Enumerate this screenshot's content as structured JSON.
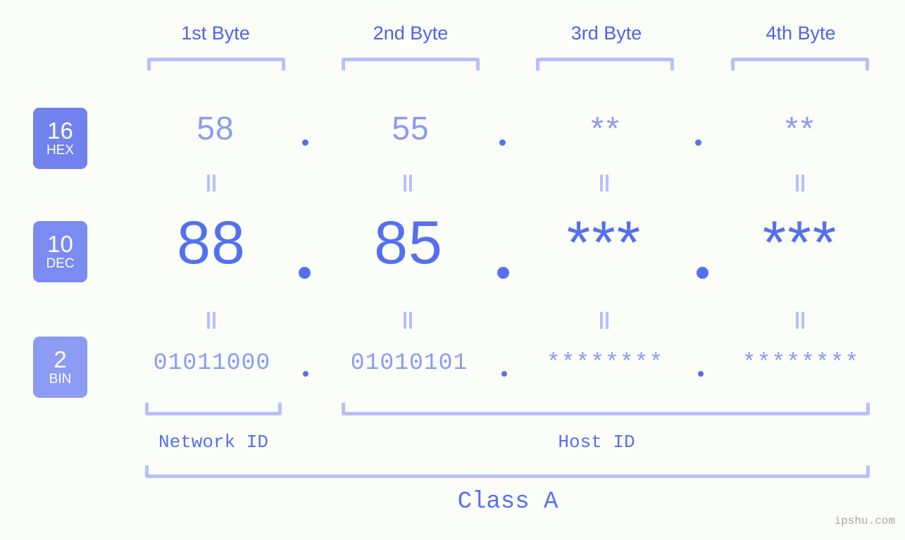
{
  "meta": {
    "background": "#fbfdf8",
    "accent_strong": "#5570ef",
    "accent_light": "#8b9bf2",
    "bracket_color": "#b7c0fb",
    "badge_hex_bg": "#7181ee",
    "badge_dec_bg": "#7b8bf1",
    "badge_bin_bg": "#8c9bf4"
  },
  "byte_headers": [
    {
      "label": "1st Byte"
    },
    {
      "label": "2nd Byte"
    },
    {
      "label": "3rd Byte"
    },
    {
      "label": "4th Byte"
    }
  ],
  "radix_badges": [
    {
      "number": "16",
      "label": "HEX"
    },
    {
      "number": "10",
      "label": "DEC"
    },
    {
      "number": "2",
      "label": "BIN"
    }
  ],
  "rows": {
    "hex": {
      "radix": "16",
      "radix_label": "HEX",
      "values": [
        "58",
        "55",
        "**",
        "**"
      ],
      "separator": "."
    },
    "dec": {
      "radix": "10",
      "radix_label": "DEC",
      "values": [
        "88",
        "85",
        "***",
        "***"
      ],
      "separator": "."
    },
    "bin": {
      "radix": "2",
      "radix_label": "BIN",
      "values": [
        "01011000",
        "01010101",
        "********",
        "********"
      ],
      "separator": "."
    }
  },
  "equality_marks": {
    "symbol": "=",
    "count_per_row": 4,
    "rows": 2
  },
  "sections": [
    {
      "label": "Network ID"
    },
    {
      "label": "Host ID"
    }
  ],
  "class_label": "Class A",
  "watermark": "ipshu.com"
}
